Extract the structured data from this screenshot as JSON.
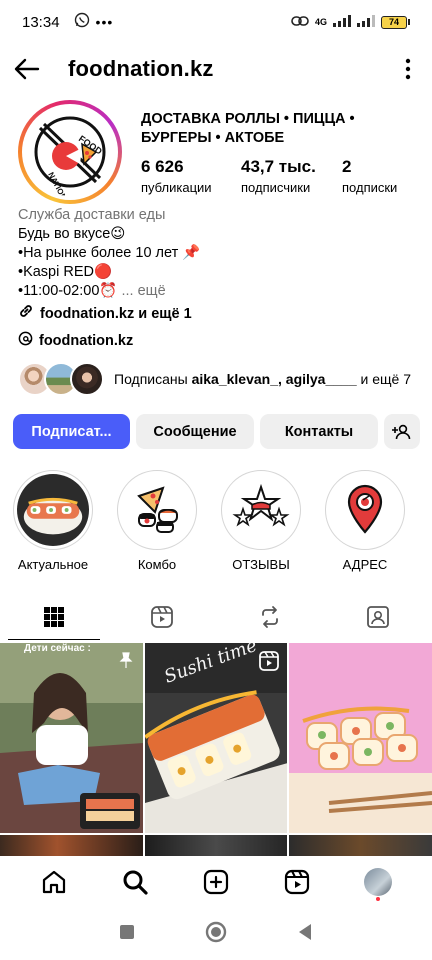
{
  "status_bar": {
    "time": "13:34",
    "network": "4G",
    "battery": "74"
  },
  "header": {
    "username": "foodnation.kz"
  },
  "profile": {
    "logo_text_top": "FOOD",
    "logo_text_bottom": "NATION",
    "title": "ДОСТАВКА РОЛЛЫ • ПИЦЦА • БУРГЕРЫ • АКТОБЕ",
    "stats": [
      {
        "value": "6 626",
        "label": "публикации"
      },
      {
        "value": "43,7 тыс.",
        "label": "подписчики"
      },
      {
        "value": "2",
        "label": "подписки"
      }
    ],
    "category": "Служба доставки еды",
    "bio_lines": [
      "Будь во вкусе😉",
      "•На рынке более 10 лет 📌",
      "•Kaspi RED🔴",
      "•11:00-02:00⏰"
    ],
    "more_text": "... ещё",
    "link_text": "foodnation.kz и ещё 1",
    "threads_text": "foodnation.kz",
    "followed_prefix": "Подписаны ",
    "followed_names": "aika_klevan_, agilya____",
    "followed_suffix": " и ещё 7"
  },
  "buttons": {
    "follow": "Подписат...",
    "message": "Сообщение",
    "contacts": "Контакты"
  },
  "highlights": [
    {
      "label": "Актуальное",
      "icon": "sushi-roll-photo"
    },
    {
      "label": "Комбо",
      "icon": "pizza-sushi-combo-icon"
    },
    {
      "label": "ОТЗЫВЫ",
      "icon": "stars-review-icon"
    },
    {
      "label": "АДРЕС",
      "icon": "map-pin-icon"
    }
  ],
  "grid": {
    "post1_caption": "Дети сейчас :",
    "post2_caption": "Sushi time"
  },
  "colors": {
    "primary_button": "#4a5df9",
    "secondary_button": "#efefef",
    "muted_text": "#737373",
    "notification_dot": "#ff3040"
  }
}
